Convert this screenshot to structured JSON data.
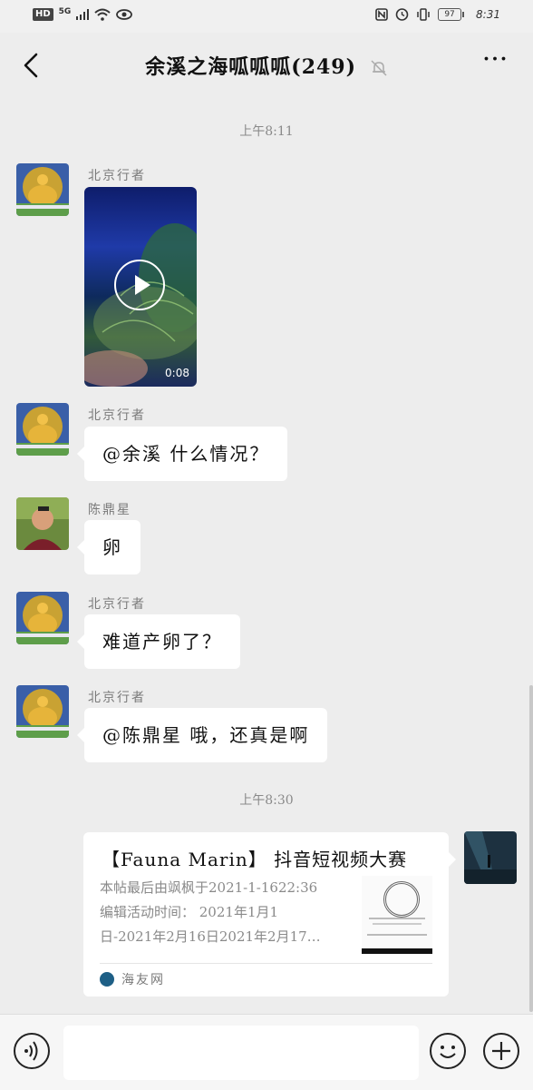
{
  "status_bar": {
    "hd": "HD",
    "network": "5G",
    "battery": "97",
    "time": "8:31"
  },
  "header": {
    "title": "余溪之海呱呱呱(249)"
  },
  "timestamps": [
    "上午8:11",
    "上午8:30"
  ],
  "messages": [
    {
      "sender": "北京行者",
      "video_duration": "0:08"
    },
    {
      "sender": "北京行者",
      "text": "@余溪  什么情况？"
    },
    {
      "sender": "陈鼎星",
      "text": "卵"
    },
    {
      "sender": "北京行者",
      "text": "难道产卵了？"
    },
    {
      "sender": "北京行者",
      "text": "@陈鼎星  哦，还真是啊"
    }
  ],
  "card": {
    "title": "【Fauna Marin】 抖音短视频大赛",
    "desc_lines": [
      "本帖最后由飒枫于2021-1-1622:36",
      "编辑活动时间： 2021年1月1",
      "日-2021年2月16日2021年2月17…"
    ],
    "source": "海友网"
  },
  "colors": {
    "background": "#ededed",
    "bubble": "#ffffff",
    "meta_text": "#8a8a8a"
  }
}
